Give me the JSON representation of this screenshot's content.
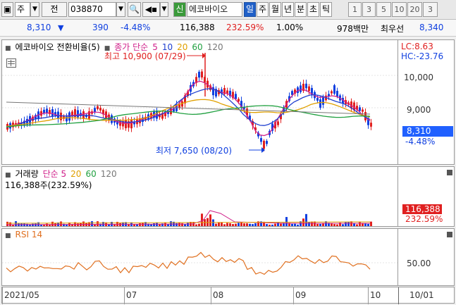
{
  "toolbar": {
    "type_label": "주",
    "jeon_label": "전",
    "code": "038870",
    "badge_sin": "신",
    "stock_name": "에코바이오",
    "periods": [
      "일",
      "주",
      "월",
      "년",
      "분",
      "초",
      "틱"
    ],
    "active_period": "일",
    "minute_options": [
      "1",
      "3",
      "5",
      "10",
      "20",
      "3"
    ]
  },
  "quote": {
    "price": "8,310",
    "change_arrow": "▼",
    "change": "390",
    "change_pct": "-4.48%",
    "volume": "116,388",
    "volume_ratio": "232.59%",
    "turnover": "1.00%",
    "amount": "978백만",
    "best_label": "최우선",
    "best_price": "8,340"
  },
  "price_panel": {
    "title": "에코바이오 전환비율(5)",
    "legend": [
      {
        "label": "종가 단순",
        "color": "#d0208a"
      },
      {
        "label": "5",
        "color": "#d0208a"
      },
      {
        "label": "10",
        "color": "#2040d0"
      },
      {
        "label": "20",
        "color": "#e0a000"
      },
      {
        "label": "60",
        "color": "#20a040"
      },
      {
        "label": "120",
        "color": "#777777"
      }
    ],
    "high_annotation": "최고 10,900 (07/29)",
    "low_annotation": "최저 7,650 (08/20)",
    "lc": "LC:8.63",
    "hc": "HC:-23.76",
    "y_ticks": [
      "10,000",
      "9,000"
    ],
    "current_tag": "8,310",
    "current_pct": "-4.48%"
  },
  "volume_panel": {
    "legend_title": "거래량",
    "legend": [
      {
        "label": "단순 5",
        "color": "#d0208a"
      },
      {
        "label": "20",
        "color": "#e0a000"
      },
      {
        "label": "60",
        "color": "#20a040"
      },
      {
        "label": "120",
        "color": "#777777"
      }
    ],
    "summary": "116,388주(232.59%)",
    "current_tag": "116,388",
    "current_pct": "232.59%"
  },
  "rsi_panel": {
    "title": "RSI 14",
    "y_tick": "50.00"
  },
  "x_axis": {
    "labels": [
      "2021/05",
      "07",
      "08",
      "09",
      "10"
    ],
    "right_label": "10/01"
  },
  "colors": {
    "up": "#e02020",
    "down": "#1040e0",
    "selected": "#2060c8"
  }
}
